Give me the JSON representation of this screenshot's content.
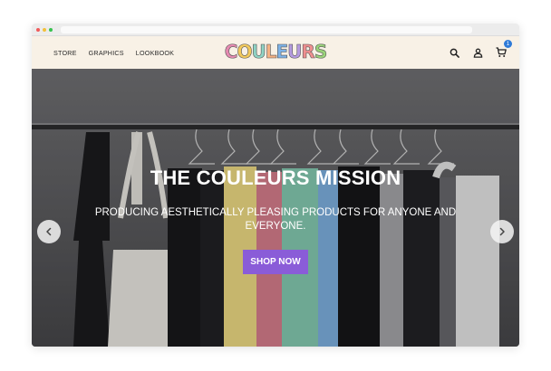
{
  "nav": {
    "items": [
      {
        "label": "STORE"
      },
      {
        "label": "GRAPHICS"
      },
      {
        "label": "LOOKBOOK"
      }
    ]
  },
  "logo": {
    "letters": [
      "C",
      "O",
      "U",
      "L",
      "E",
      "U",
      "R",
      "S"
    ],
    "colors": [
      "#e58ab1",
      "#f2c95c",
      "#8fd3c4",
      "#f4b183",
      "#7db3e8",
      "#b59be0",
      "#f08f8f",
      "#9ad27a"
    ]
  },
  "header_icons": {
    "search": "search-icon",
    "account": "user-icon",
    "cart": "cart-icon",
    "cart_count": "1"
  },
  "hero": {
    "title": "THE COULEURS MISSION",
    "subtitle": "PRODUCING AESTHETICALLY PLEASING PRODUCTS FOR ANYONE AND EVERYONE.",
    "button_label": "SHOP NOW",
    "button_color": "#8a5cd8",
    "prev_icon": "chevron-left-icon",
    "next_icon": "chevron-right-icon"
  },
  "colors": {
    "header_bg": "#f8f1e6",
    "accent": "#8a5cd8",
    "badge": "#2f7bd8"
  }
}
